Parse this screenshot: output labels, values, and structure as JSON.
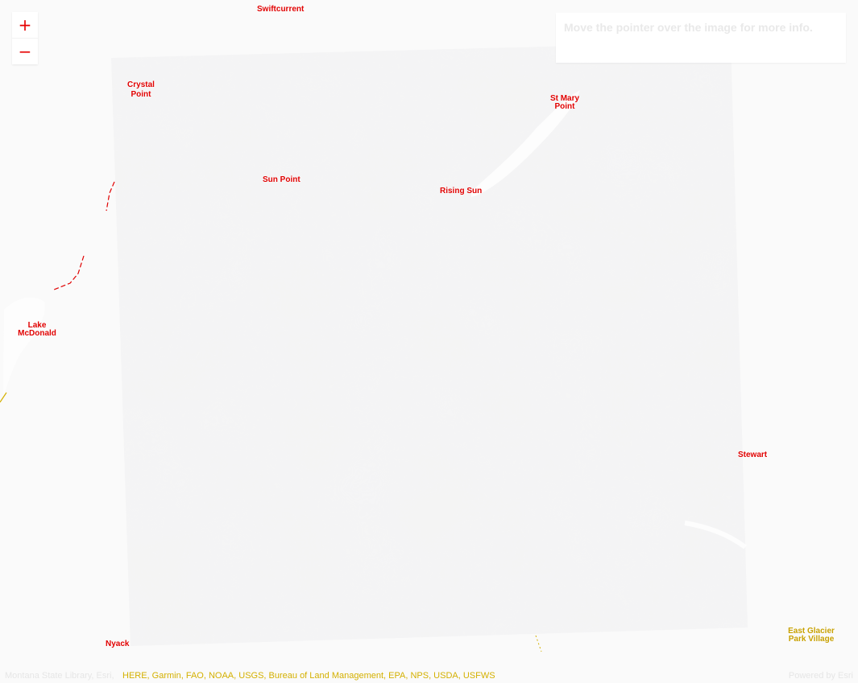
{
  "map": {
    "labels": [
      {
        "text": "Swiftcurrent",
        "color": "red",
        "pos": "top"
      },
      {
        "text": "Crystal Point",
        "color": "red",
        "pos": "nw"
      },
      {
        "text": "St Mary Point",
        "color": "red",
        "pos": "ne"
      },
      {
        "text": "Rising Sun",
        "color": "red",
        "pos": "center"
      },
      {
        "text": "Sun Point",
        "color": "red",
        "pos": "center-left"
      },
      {
        "text": "Lake McDonald",
        "color": "red",
        "pos": "west"
      },
      {
        "text": "Stewart",
        "color": "red",
        "pos": "east"
      },
      {
        "text": "Nyack",
        "color": "red",
        "pos": "sw"
      },
      {
        "text": "East Glacier Park Village",
        "color": "yellow",
        "pos": "se"
      }
    ]
  },
  "zoom": {
    "in_label": "+",
    "out_label": "−"
  },
  "info_panel": {
    "text": "Move the pointer over the image for more info."
  },
  "attribution": {
    "left": "Montana State Library, Esri,",
    "overlay": "HERE, Garmin, FAO, NOAA, USGS, Bureau of Land Management, EPA, NPS, USDA, USFWS",
    "right": "Powered by Esri"
  }
}
